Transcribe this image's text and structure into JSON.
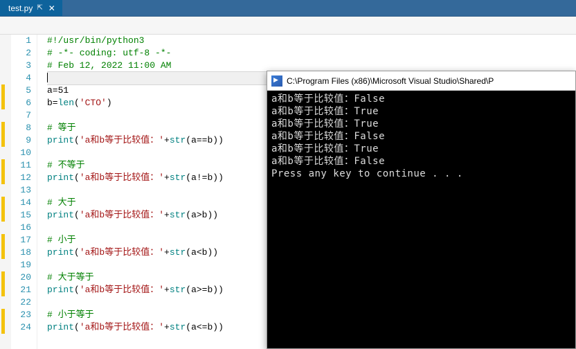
{
  "tab": {
    "title": "test.py",
    "pin_glyph": "⇱",
    "close_glyph": "✕"
  },
  "code": {
    "lines": [
      {
        "n": 1,
        "mark": false,
        "tokens": [
          [
            "cm",
            "#!/usr/bin/python3"
          ]
        ]
      },
      {
        "n": 2,
        "mark": false,
        "tokens": [
          [
            "cm",
            "# -*- coding: utf-8 -*-"
          ]
        ]
      },
      {
        "n": 3,
        "mark": false,
        "tokens": [
          [
            "cm",
            "# Feb 12, 2022 11:00 AM"
          ]
        ]
      },
      {
        "n": 4,
        "mark": false,
        "current": true,
        "tokens": []
      },
      {
        "n": 5,
        "mark": true,
        "tokens": [
          [
            "op",
            "a=51"
          ]
        ]
      },
      {
        "n": 6,
        "mark": true,
        "tokens": [
          [
            "op",
            "b="
          ],
          [
            "fn",
            "len"
          ],
          [
            "op",
            "("
          ],
          [
            "str",
            "'CTO'"
          ],
          [
            "op",
            ")"
          ]
        ]
      },
      {
        "n": 7,
        "mark": false,
        "tokens": []
      },
      {
        "n": 8,
        "mark": true,
        "tokens": [
          [
            "cm",
            "# 等于"
          ]
        ]
      },
      {
        "n": 9,
        "mark": true,
        "tokens": [
          [
            "fn",
            "print"
          ],
          [
            "op",
            "("
          ],
          [
            "str",
            "'a和b等于比较值：'"
          ],
          [
            "op",
            "+"
          ],
          [
            "fn",
            "str"
          ],
          [
            "op",
            "(a==b))"
          ]
        ]
      },
      {
        "n": 10,
        "mark": false,
        "tokens": []
      },
      {
        "n": 11,
        "mark": true,
        "tokens": [
          [
            "cm",
            "# 不等于"
          ]
        ]
      },
      {
        "n": 12,
        "mark": true,
        "tokens": [
          [
            "fn",
            "print"
          ],
          [
            "op",
            "("
          ],
          [
            "str",
            "'a和b等于比较值：'"
          ],
          [
            "op",
            "+"
          ],
          [
            "fn",
            "str"
          ],
          [
            "op",
            "(a!=b))"
          ]
        ]
      },
      {
        "n": 13,
        "mark": false,
        "tokens": []
      },
      {
        "n": 14,
        "mark": true,
        "tokens": [
          [
            "cm",
            "# 大于"
          ]
        ]
      },
      {
        "n": 15,
        "mark": true,
        "tokens": [
          [
            "fn",
            "print"
          ],
          [
            "op",
            "("
          ],
          [
            "str",
            "'a和b等于比较值：'"
          ],
          [
            "op",
            "+"
          ],
          [
            "fn",
            "str"
          ],
          [
            "op",
            "(a>b))"
          ]
        ]
      },
      {
        "n": 16,
        "mark": false,
        "tokens": []
      },
      {
        "n": 17,
        "mark": true,
        "tokens": [
          [
            "cm",
            "# 小于"
          ]
        ]
      },
      {
        "n": 18,
        "mark": true,
        "tokens": [
          [
            "fn",
            "print"
          ],
          [
            "op",
            "("
          ],
          [
            "str",
            "'a和b等于比较值：'"
          ],
          [
            "op",
            "+"
          ],
          [
            "fn",
            "str"
          ],
          [
            "op",
            "(a<b))"
          ]
        ]
      },
      {
        "n": 19,
        "mark": false,
        "tokens": []
      },
      {
        "n": 20,
        "mark": true,
        "tokens": [
          [
            "cm",
            "# 大于等于"
          ]
        ]
      },
      {
        "n": 21,
        "mark": true,
        "tokens": [
          [
            "fn",
            "print"
          ],
          [
            "op",
            "("
          ],
          [
            "str",
            "'a和b等于比较值：'"
          ],
          [
            "op",
            "+"
          ],
          [
            "fn",
            "str"
          ],
          [
            "op",
            "(a>=b))"
          ]
        ]
      },
      {
        "n": 22,
        "mark": false,
        "tokens": []
      },
      {
        "n": 23,
        "mark": true,
        "tokens": [
          [
            "cm",
            "# 小于等于"
          ]
        ]
      },
      {
        "n": 24,
        "mark": true,
        "tokens": [
          [
            "fn",
            "print"
          ],
          [
            "op",
            "("
          ],
          [
            "str",
            "'a和b等于比较值：'"
          ],
          [
            "op",
            "+"
          ],
          [
            "fn",
            "str"
          ],
          [
            "op",
            "(a<=b))"
          ]
        ]
      }
    ]
  },
  "console": {
    "title": "C:\\Program Files (x86)\\Microsoft Visual Studio\\Shared\\P",
    "output": [
      "a和b等于比较值：False",
      "a和b等于比较值：True",
      "a和b等于比较值：True",
      "a和b等于比较值：False",
      "a和b等于比较值：True",
      "a和b等于比较值：False",
      "Press any key to continue . . ."
    ]
  }
}
